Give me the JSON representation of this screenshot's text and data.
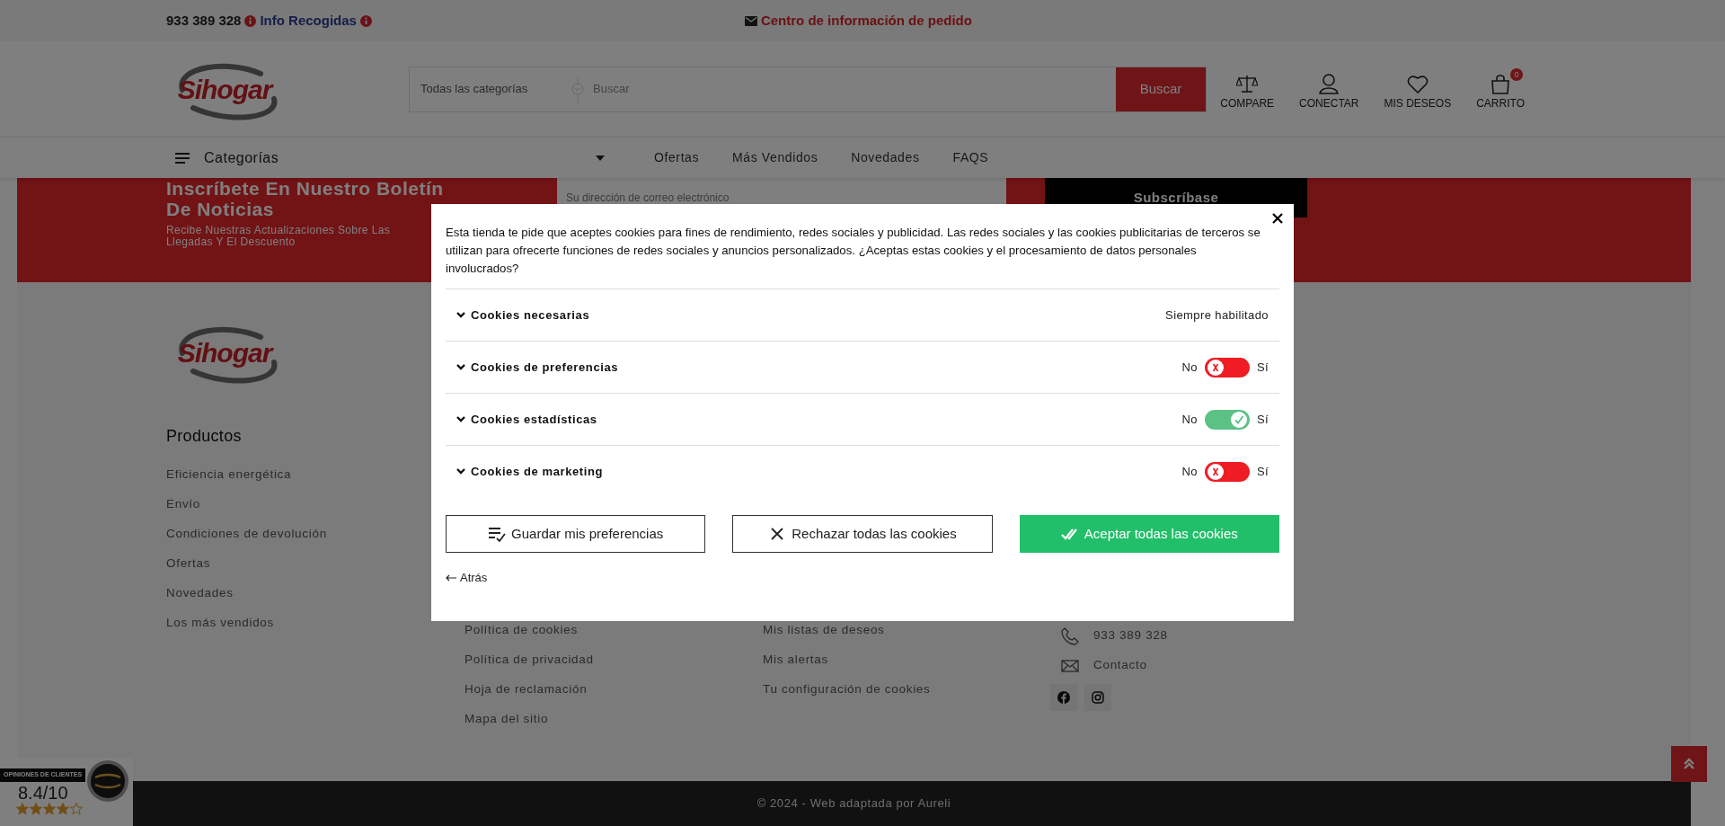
{
  "top_bar": {
    "phone": "933 389 328",
    "info_link": "Info Recogidas",
    "order_center": "Centro de información de pedido"
  },
  "header": {
    "logo": "Sihogar",
    "search": {
      "category": "Todas las categorías",
      "placeholder": "Buscar",
      "button": "Buscar"
    },
    "actions": [
      {
        "kind": "compare",
        "label": "COMPARE"
      },
      {
        "kind": "account",
        "label": "CONECTAR"
      },
      {
        "kind": "wishlist",
        "label": "MIS DESEOS"
      },
      {
        "kind": "cart",
        "label": "CARRITO",
        "badge": "0"
      }
    ]
  },
  "nav": {
    "categories": "Categorías",
    "links": [
      "Ofertas",
      "Más Vendidos",
      "Novedades",
      "FAQS"
    ]
  },
  "newsletter": {
    "title": "Inscríbete En Nuestro Boletín De Noticias",
    "subtitle_lines": [
      "Recibe Nuestras Actualizaciones Sobre Las",
      "Llegadas Y El Descuento"
    ],
    "email_placeholder": "Su dirección de correo electrónico",
    "button": "Subscríbase"
  },
  "footer": {
    "logo": "Sihogar",
    "columns": [
      {
        "title": "Productos",
        "links": [
          "Eficiencia energética",
          "Envío",
          "Condiciones de devolución",
          "Ofertas",
          "Novedades",
          "Los más vendidos"
        ]
      },
      {
        "links": [
          "Política de cookies",
          "Política de privacidad",
          "Hoja de reclamación",
          "Mapa del sitio"
        ]
      },
      {
        "links": [
          "Mis listas de deseos",
          "Mis alertas",
          "Tu configuración de cookies"
        ]
      }
    ],
    "contact": [
      {
        "kind": "phone",
        "text": "933 389 328"
      },
      {
        "kind": "email",
        "text": "Contacto"
      }
    ],
    "copyright": "© 2024 - Web adaptada por Aureli"
  },
  "reviews_badge": {
    "title": "OPINIONES DE CLIENTES",
    "score": "8.4/10",
    "stars": 4
  },
  "cookie_modal": {
    "intro": "Esta tienda te pide que aceptes cookies para fines de rendimiento, redes sociales y publicidad. Las redes sociales y las cookies publicitarias de terceros se utilizan para ofrecerte funciones de redes sociales y anuncios personalizados. ¿Aceptas estas cookies y el procesamiento de datos personales involucrados?",
    "categories": [
      {
        "kind": "always",
        "name": "Cookies necesarias",
        "status": "Siempre habilitado"
      },
      {
        "kind": "toggle",
        "name": "Cookies de preferencias",
        "off_label": "No",
        "on_label": "Sí",
        "on": false
      },
      {
        "kind": "toggle",
        "name": "Cookies estadísticas",
        "off_label": "No",
        "on_label": "Sí",
        "on": true
      },
      {
        "kind": "toggle",
        "name": "Cookies de marketing",
        "off_label": "No",
        "on_label": "Sí",
        "on": false
      }
    ],
    "buttons": [
      {
        "kind": "save",
        "label": "Guardar mis preferencias"
      },
      {
        "kind": "reject",
        "label": "Rechazar todas las cookies"
      },
      {
        "kind": "accept",
        "label": "Aceptar todas las cookies"
      }
    ],
    "back": "Atrás"
  }
}
